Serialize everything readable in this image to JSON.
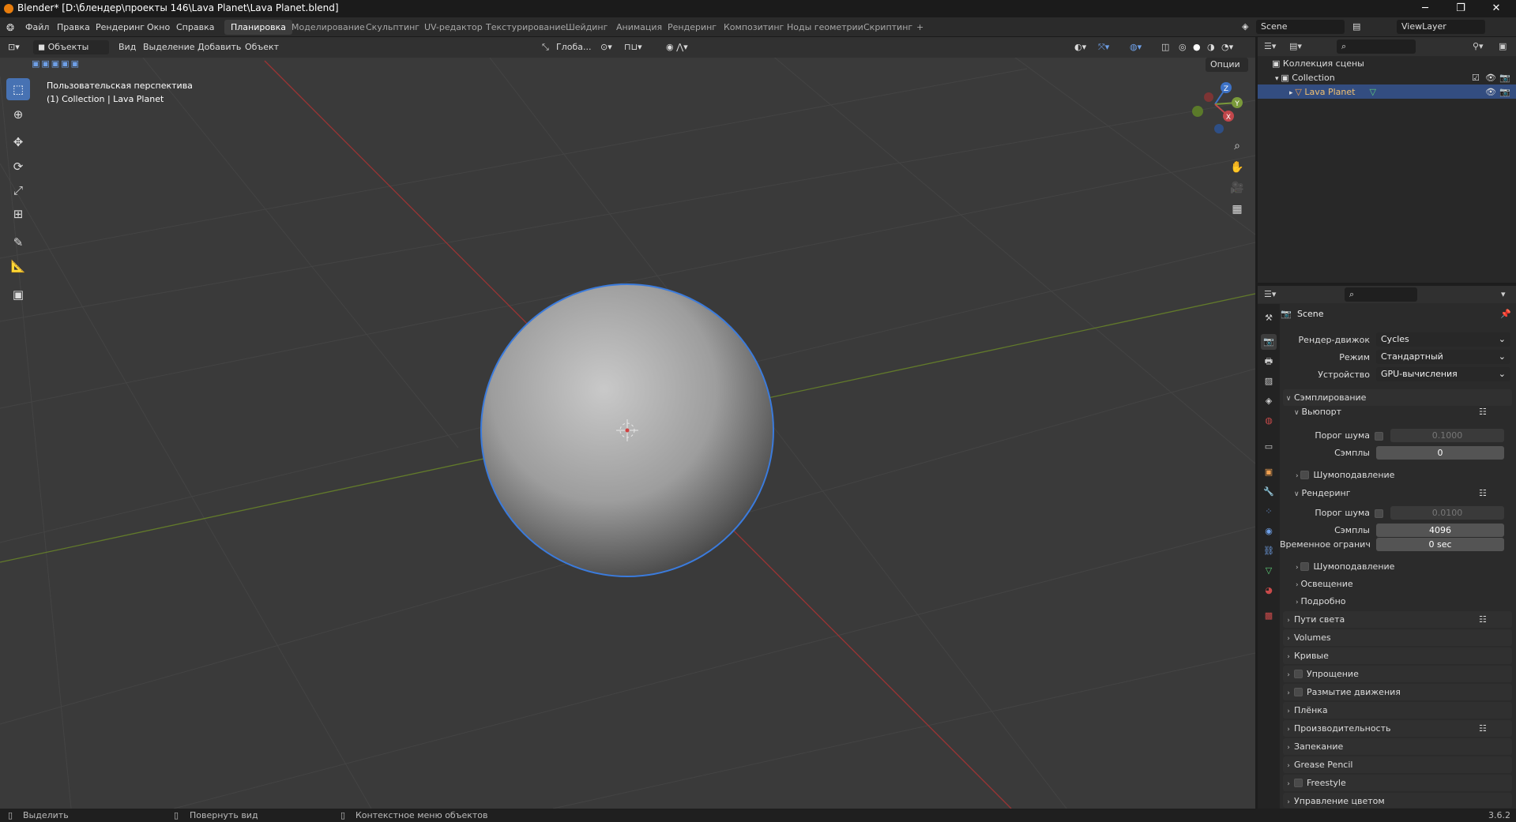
{
  "window": {
    "title": "Blender* [D:\\блендер\\проекты 146\\Lava Planet\\Lava Planet.blend]",
    "minimize": "─",
    "maximize": "❐",
    "close": "✕"
  },
  "menu": {
    "file": "Файл",
    "edit": "Правка",
    "render": "Рендеринг",
    "window": "Окно",
    "help": "Справка"
  },
  "workspaces": [
    "Планировка",
    "Моделирование",
    "Скульптинг",
    "UV-редактор",
    "Текстурирование",
    "Шейдинг",
    "Анимация",
    "Рендеринг",
    "Композитинг",
    "Ноды геометрии",
    "Скриптинг",
    "+"
  ],
  "scene_field": "Scene",
  "viewlayer_field": "ViewLayer",
  "viewport": {
    "mode": "Объекты",
    "menu_view": "Вид",
    "menu_select": "Выделение",
    "menu_add": "Добавить",
    "menu_object": "Объект",
    "orientation": "Глоба...",
    "options": "Опции",
    "overlay_title": "Пользовательская перспектива",
    "overlay_collection": "(1) Collection | Lava Planet",
    "gizmo_x": "X",
    "gizmo_y": "Y",
    "gizmo_z": "Z"
  },
  "outliner": {
    "scene_collection": "Коллекция сцены",
    "collection": "Collection",
    "object": "Lava Planet"
  },
  "properties": {
    "scene": "Scene",
    "render_engine_label": "Рендер-движок",
    "render_engine": "Cycles",
    "mode_label": "Режим",
    "mode": "Стандартный",
    "device_label": "Устройство",
    "device": "GPU-вычисления",
    "sampling": "Сэмплирование",
    "viewport": "Вьюпорт",
    "noise_threshold_label": "Порог шума",
    "vp_noise_threshold": "0.1000",
    "samples_label": "Сэмплы",
    "vp_samples": "0",
    "denoise": "Шумоподавление",
    "render": "Рендеринг",
    "r_noise_threshold": "0.0100",
    "r_samples": "4096",
    "time_limit_label": "Временное огранич...",
    "time_limit": "0 sec",
    "r_denoise": "Шумоподавление",
    "lighting": "Освещение",
    "advanced": "Подробно",
    "light_paths": "Пути света",
    "volumes": "Volumes",
    "curves": "Кривые",
    "simplify": "Упрощение",
    "motion_blur": "Размытие движения",
    "film": "Плёнка",
    "performance": "Производительность",
    "bake": "Запекание",
    "grease_pencil": "Grease Pencil",
    "freestyle": "Freestyle",
    "color_management": "Управление цветом"
  },
  "status": {
    "select": "Выделить",
    "rotate": "Повернуть вид",
    "context": "Контекстное меню объектов",
    "version": "3.6.2"
  },
  "colors": {
    "accent": "#4772b3",
    "selection_outline": "#3b7bdc",
    "x_axis": "#c2474b",
    "y_axis": "#7a9a3a",
    "z_axis": "#3d72c6"
  }
}
